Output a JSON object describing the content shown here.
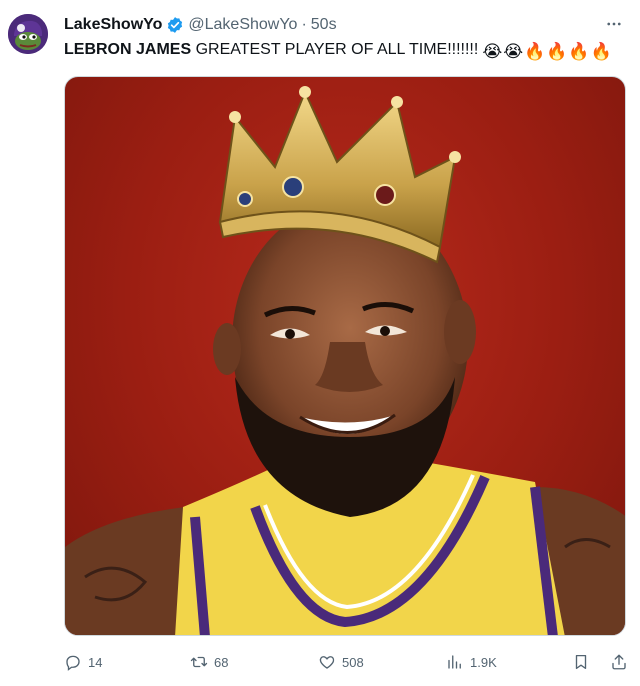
{
  "author": {
    "display_name": "LakeShowYo",
    "handle": "@LakeShowYo",
    "separator": "·",
    "time": "50s"
  },
  "tweet": {
    "text_bold": "LEBRON JAMES",
    "text_rest": " GREATEST PLAYER OF ALL TIME!!!!!!!",
    "emojis": [
      "😭",
      "😭",
      "🔥",
      "🔥",
      "🔥",
      "🔥"
    ]
  },
  "media": {
    "icon": "photo-lebron-crown"
  },
  "actions": {
    "reply_count": "14",
    "retweet_count": "68",
    "like_count": "508",
    "views_count": "1.9K"
  },
  "colors": {
    "verified": "#1d9bf0",
    "secondary_text": "#536471",
    "media_background": "#9b1e12",
    "jersey": "#f2d54a",
    "jersey_trim": "#4a2a7a"
  }
}
